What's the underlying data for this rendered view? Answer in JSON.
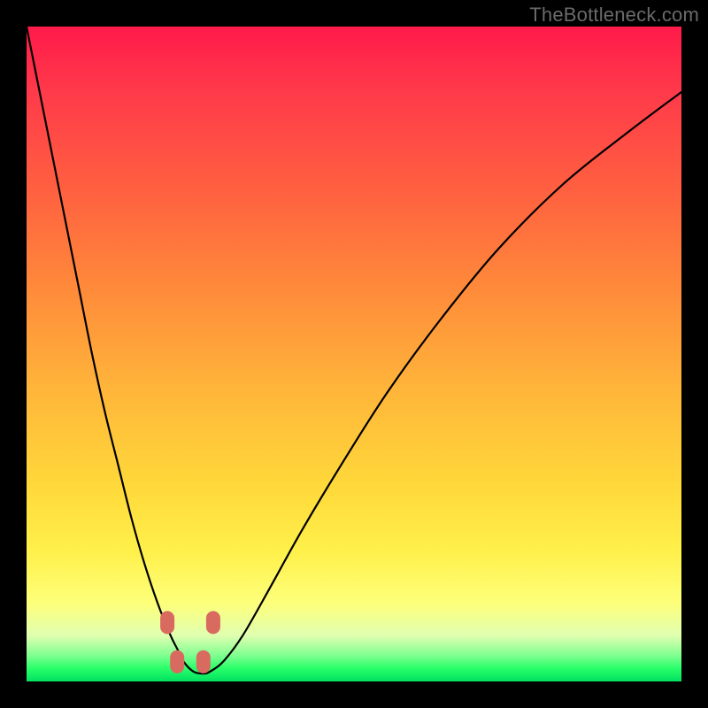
{
  "watermark": "TheBottleneck.com",
  "chart_data": {
    "type": "line",
    "title": "",
    "xlabel": "",
    "ylabel": "",
    "xlim": [
      0,
      100
    ],
    "ylim": [
      0,
      100
    ],
    "series": [
      {
        "name": "bottleneck-curve",
        "x": [
          0,
          2,
          4,
          6,
          8,
          10,
          12,
          14,
          16,
          18,
          20,
          22,
          23,
          24,
          25.5,
          27,
          28,
          30,
          33,
          37,
          42,
          48,
          55,
          63,
          72,
          82,
          92,
          100
        ],
        "values": [
          100,
          90,
          80,
          70,
          60,
          50,
          41,
          33,
          25,
          18,
          12,
          7,
          5,
          3,
          1.5,
          1.2,
          1.5,
          3,
          7,
          14,
          23,
          33,
          44,
          55,
          66,
          76,
          84,
          90
        ]
      }
    ],
    "markers": [
      {
        "x": 21.5,
        "y": 9
      },
      {
        "x": 23.0,
        "y": 3
      },
      {
        "x": 27.0,
        "y": 3
      },
      {
        "x": 28.5,
        "y": 9
      }
    ],
    "background_gradient": {
      "top": "#ff1a4a",
      "bottom": "#00e060"
    }
  }
}
